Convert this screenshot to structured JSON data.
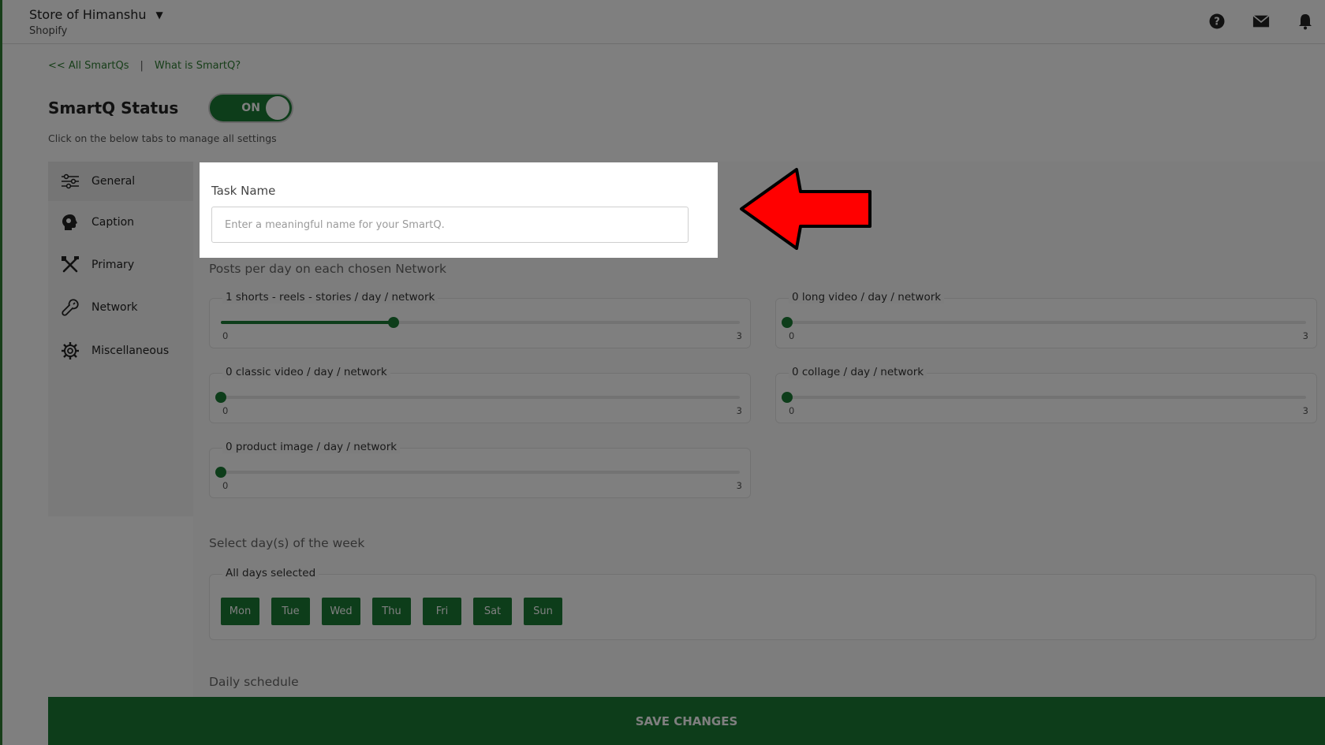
{
  "header": {
    "store_name": "Store of Himanshu",
    "platform": "Shopify",
    "icons": [
      "help-icon",
      "mail-icon",
      "bell-icon"
    ]
  },
  "breadcrumb": {
    "back_link": "<< All SmartQs",
    "separator": "|",
    "info_link": "What is SmartQ?"
  },
  "status": {
    "title": "SmartQ Status",
    "toggle_label": "ON",
    "hint": "Click on the below tabs to manage all settings"
  },
  "sidebar": {
    "items": [
      {
        "label": "General",
        "icon": "sliders-icon"
      },
      {
        "label": "Caption",
        "icon": "head-icon"
      },
      {
        "label": "Primary",
        "icon": "tools-icon"
      },
      {
        "label": "Network",
        "icon": "wrench-icon"
      },
      {
        "label": "Miscellaneous",
        "icon": "cog-icon"
      }
    ]
  },
  "task": {
    "label": "Task Name",
    "placeholder": "Enter a meaningful name for your SmartQ.",
    "value": ""
  },
  "posts": {
    "title": "Posts per day on each chosen Network",
    "sliders": [
      {
        "label": "1 shorts - reels - stories / day / network",
        "min": "0",
        "max": "3",
        "value": 1
      },
      {
        "label": "0 long video / day / network",
        "min": "0",
        "max": "3",
        "value": 0
      },
      {
        "label": "0 classic video / day / network",
        "min": "0",
        "max": "3",
        "value": 0
      },
      {
        "label": "0 collage / day / network",
        "min": "0",
        "max": "3",
        "value": 0
      },
      {
        "label": "0 product image / day / network",
        "min": "0",
        "max": "3",
        "value": 0
      }
    ]
  },
  "days": {
    "title": "Select day(s) of the week",
    "legend": "All days selected",
    "items": [
      "Mon",
      "Tue",
      "Wed",
      "Thu",
      "Fri",
      "Sat",
      "Sun"
    ]
  },
  "schedule": {
    "title": "Daily schedule"
  },
  "footer": {
    "save_label": "SAVE CHANGES"
  },
  "colors": {
    "brand_green": "#1b7a35",
    "arrow_red": "#ff0000"
  }
}
